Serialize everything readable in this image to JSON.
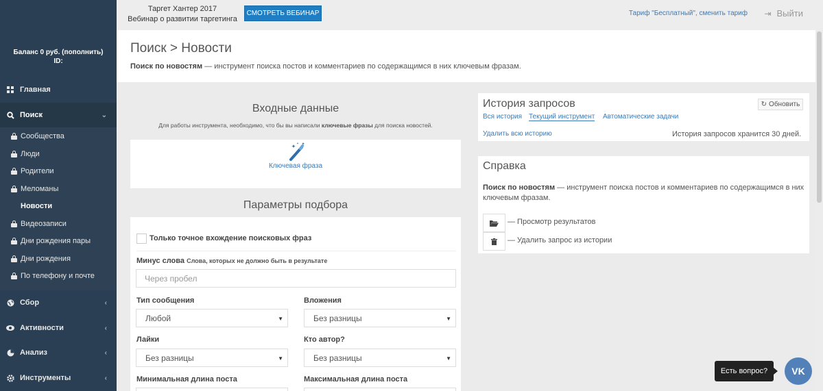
{
  "sidebar": {
    "balance_line1": "Баланс 0 руб. (пополнить)",
    "balance_line2": "ID:",
    "nav": [
      {
        "label": "Главная",
        "icon": "dashboard-icon"
      },
      {
        "label": "Поиск",
        "icon": "search-icon"
      },
      {
        "label": "Сбор",
        "icon": "globe-icon"
      },
      {
        "label": "Активности",
        "icon": "eye-icon"
      },
      {
        "label": "Анализ",
        "icon": "pie-chart-icon"
      },
      {
        "label": "Инструменты",
        "icon": "gear-icon"
      }
    ],
    "submenu": [
      {
        "label": "Сообщества"
      },
      {
        "label": "Люди"
      },
      {
        "label": "Родители"
      },
      {
        "label": "Меломаны"
      },
      {
        "label": "Новости"
      },
      {
        "label": "Видеозаписи"
      },
      {
        "label": "Дни рождения пары"
      },
      {
        "label": "Дни рождения"
      },
      {
        "label": "По телефону и почте"
      }
    ]
  },
  "topbar": {
    "webinar_line1": "Таргет Хантер 2017",
    "webinar_line2": "Вебинар о развитии таргетинга",
    "webinar_button": "СМОТРЕТЬ ВЕБИНАР",
    "tariff": "Тариф \"Бесплатный\", сменить тариф",
    "logout": "Выйти"
  },
  "page": {
    "title": "Поиск > Новости",
    "desc_bold": "Поиск по новостям",
    "desc_rest": " — инструмент поиска постов и комментариев по содержащимся в них ключевым фразам."
  },
  "input_section": {
    "title": "Входные данные",
    "sub_pre": "Для работы инструмента, необходимо, что бы вы написали ",
    "sub_bold": "ключевые фразы",
    "sub_post": " для поиска новостей.",
    "keyphrase_label": "Ключевая фраза"
  },
  "params": {
    "title": "Параметры подбора",
    "exact_match": "Только точное вхождение поисковых фраз",
    "minus_label": "Минус слова",
    "minus_hint": "Слова, которых не должно быть в результате",
    "minus_placeholder": "Через пробел",
    "msg_type_label": "Тип сообщения",
    "msg_type_value": "Любой",
    "attachments_label": "Вложения",
    "attachments_value": "Без разницы",
    "likes_label": "Лайки",
    "likes_value": "Без разницы",
    "author_label": "Кто автор?",
    "author_value": "Без разницы",
    "min_len_label": "Минимальная длина поста",
    "max_len_label": "Максимальная длина поста"
  },
  "history": {
    "title": "История запросов",
    "refresh": "Обновить",
    "tabs": [
      "Вся история",
      "Текущий инструмент",
      "Автоматические задачи"
    ],
    "delete_all": "Удалить всю историю",
    "keep_note": "История запросов хранится 30 дней."
  },
  "help": {
    "title": "Справка",
    "desc_bold": "Поиск по новостям",
    "desc_rest": " — инструмент поиска постов и комментариев по содержащимся в них ключевым фразам.",
    "view_results": "— Просмотр результатов",
    "delete_request": "— Удалить запрос из истории"
  },
  "chat": {
    "question": "Есть вопрос?",
    "vk": "VK"
  }
}
